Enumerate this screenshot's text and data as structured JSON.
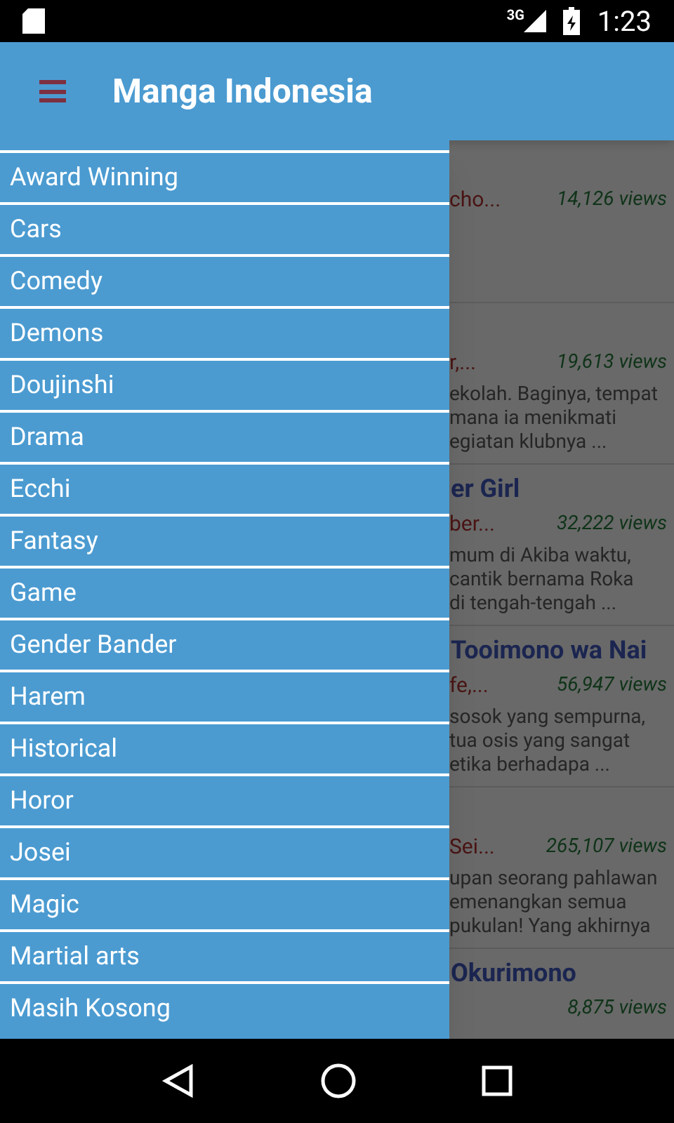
{
  "status_bar": {
    "network": "3G",
    "time": "1:23"
  },
  "app_bar": {
    "title": "Manga Indonesia"
  },
  "drawer": {
    "items": [
      {
        "label": "Award Winning"
      },
      {
        "label": "Cars"
      },
      {
        "label": "Comedy"
      },
      {
        "label": "Demons"
      },
      {
        "label": "Doujinshi"
      },
      {
        "label": "Drama"
      },
      {
        "label": "Ecchi"
      },
      {
        "label": "Fantasy"
      },
      {
        "label": "Game"
      },
      {
        "label": "Gender Bander"
      },
      {
        "label": "Harem"
      },
      {
        "label": "Historical"
      },
      {
        "label": "Horor"
      },
      {
        "label": "Josei"
      },
      {
        "label": "Magic"
      },
      {
        "label": "Martial arts"
      },
      {
        "label": "Masih Kosong"
      }
    ]
  },
  "manga_list": [
    {
      "subtitle": "cho...",
      "views": "14,126 views"
    },
    {
      "subtitle": "r,...",
      "views": "19,613 views",
      "description": [
        "ekolah. Baginya, tempat",
        "mana ia menikmati",
        "egiatan klubnya ..."
      ]
    },
    {
      "title": "er Girl",
      "subtitle": "ber...",
      "views": "32,222 views",
      "description": [
        "mum di Akiba waktu,",
        "cantik bernama Roka",
        "di tengah-tengah ..."
      ]
    },
    {
      "title": "Tooimono wa Nai",
      "subtitle": "fe,...",
      "views": "56,947 views",
      "description": [
        "sosok yang sempurna,",
        "tua osis yang sangat",
        "etika berhadapa ..."
      ]
    },
    {
      "subtitle": "Sei...",
      "views": "265,107 views",
      "description": [
        "upan seorang pahlawan",
        "emenangkan semua",
        "pukulan! Yang akhirnya"
      ]
    },
    {
      "title": "Okurimono",
      "views": "8,875 views"
    }
  ]
}
